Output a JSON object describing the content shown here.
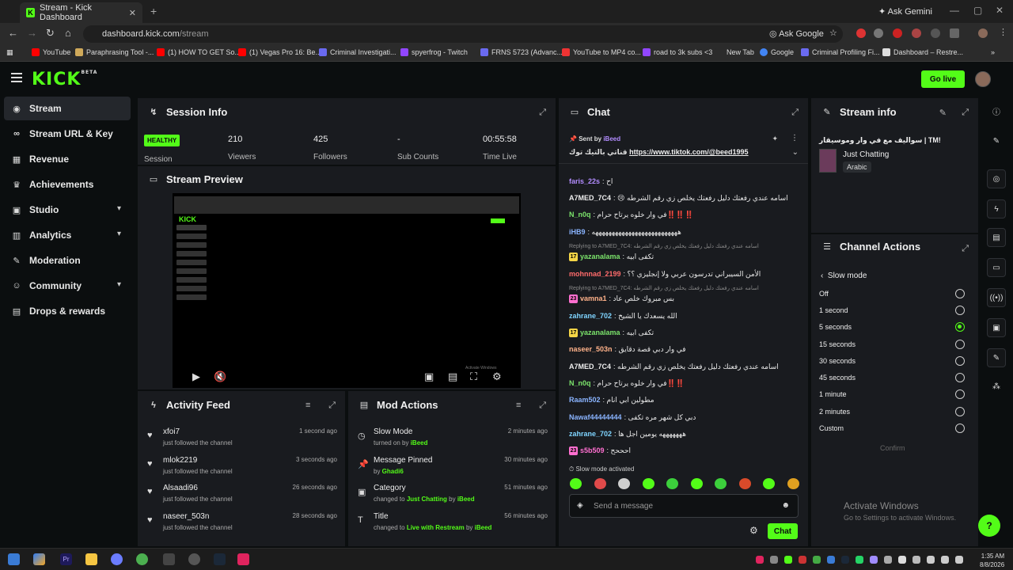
{
  "browser": {
    "tab_title": "Stream - Kick Dashboard",
    "tab_favicon": "K",
    "ask_gemini": "Ask Gemini",
    "url_domain": "dashboard.kick.com",
    "url_path": "/stream",
    "ask_google": "Ask Google",
    "bookmarks": [
      {
        "label": "YouTube",
        "color": "#ff0000"
      },
      {
        "label": "Paraphrasing Tool -...",
        "color": "#cfa95a"
      },
      {
        "label": "(1) HOW TO GET So...",
        "color": "#ff0000"
      },
      {
        "label": "(1) Vegas Pro 16: Be...",
        "color": "#ff0000"
      },
      {
        "label": "Criminal Investigati...",
        "color": "#6a6af0"
      },
      {
        "label": "spyerfrog - Twitch",
        "color": "#9146ff"
      },
      {
        "label": "FRNS 5723 (Advanc...",
        "color": "#6a6af0"
      },
      {
        "label": "YouTube to MP4 co...",
        "color": "#e33"
      },
      {
        "label": "road to 3k subs <3",
        "color": "#9146ff"
      },
      {
        "label": "New Tab",
        "color": "#2b2b2b"
      },
      {
        "label": "Google",
        "color": "#4285f4"
      },
      {
        "label": "Criminal Profiling Fi...",
        "color": "#6a6af0"
      },
      {
        "label": "Dashboard – Restre...",
        "color": "#ddd"
      }
    ]
  },
  "header": {
    "logo": "KICK",
    "logo_badge": "BETA",
    "go_live": "Go live"
  },
  "sidebar": {
    "items": [
      {
        "label": "Stream",
        "icon": "broadcast-icon",
        "glyph": "◉"
      },
      {
        "label": "Stream URL & Key",
        "icon": "link-icon",
        "glyph": "🔗"
      },
      {
        "label": "Revenue",
        "icon": "chart-icon",
        "glyph": "▦"
      },
      {
        "label": "Achievements",
        "icon": "trophy-icon",
        "glyph": "🏆"
      },
      {
        "label": "Studio",
        "icon": "layout-icon",
        "glyph": "▣"
      },
      {
        "label": "Analytics",
        "icon": "analytics-icon",
        "glyph": "▥"
      },
      {
        "label": "Moderation",
        "icon": "wrench-icon",
        "glyph": "✎"
      },
      {
        "label": "Community",
        "icon": "users-icon",
        "glyph": "☺"
      },
      {
        "label": "Drops & rewards",
        "icon": "gift-icon",
        "glyph": "▤"
      }
    ]
  },
  "session": {
    "title": "Session Info",
    "health": "HEALTHY",
    "label": "Session",
    "stats": [
      {
        "value": "210",
        "label": "Viewers"
      },
      {
        "value": "425",
        "label": "Followers"
      },
      {
        "value": "-",
        "label": "Sub Counts"
      },
      {
        "value": "00:55:58",
        "label": "Time Live"
      }
    ]
  },
  "preview": {
    "title": "Stream Preview",
    "activate_text": "Activate Windows"
  },
  "activity": {
    "title": "Activity Feed",
    "items": [
      {
        "name": "xfoi7",
        "sub": "just followed the channel",
        "time": "1 second ago"
      },
      {
        "name": "mlok2219",
        "sub": "just followed the channel",
        "time": "3 seconds ago"
      },
      {
        "name": "Alsaadi96",
        "sub": "just followed the channel",
        "time": "26 seconds ago"
      },
      {
        "name": "naseer_503n",
        "sub": "just followed the channel",
        "time": "28 seconds ago"
      }
    ]
  },
  "mod_actions": {
    "title": "Mod Actions",
    "items": [
      {
        "name": "Slow Mode",
        "pre": "turned on by ",
        "hl": "iBeed",
        "mid": "",
        "hl2": "",
        "time": "2 minutes ago",
        "icon": "clock-icon",
        "glyph": "◷"
      },
      {
        "name": "Message Pinned",
        "pre": "by ",
        "hl": "Ghadi6",
        "mid": "",
        "hl2": "",
        "time": "30 minutes ago",
        "icon": "pin-icon",
        "glyph": "✦"
      },
      {
        "name": "Category",
        "pre": "changed to ",
        "hl": "Just Chatting",
        "mid": " by ",
        "hl2": "iBeed",
        "time": "51 minutes ago",
        "icon": "category-icon",
        "glyph": "▣"
      },
      {
        "name": "Title",
        "pre": "changed to ",
        "hl": "Live with Restream",
        "mid": " by ",
        "hl2": "iBeed",
        "time": "56 minutes ago",
        "icon": "text-icon",
        "glyph": "T"
      }
    ]
  },
  "chat": {
    "title": "Chat",
    "pinned_sent_by": "Sent by",
    "pinned_user": "iBeed",
    "pinned_text": "قناتي بالتيك توك",
    "pinned_link": "https://www.tiktok.com/@beed1995",
    "messages": [
      {
        "user": "faris_22s",
        "color": "#b28cff",
        "text": "اح",
        "badge": ""
      },
      {
        "user": "A7MED_7C4",
        "color": "#eeeeee",
        "text": "😢 اسامه عندي رفعتك دليل رفعتك يخلص زي رقم الشرطه",
        "badge": ""
      },
      {
        "user": "N_n0q",
        "color": "#7be36b",
        "text": "في وار خلوه يرتاح حرام‼️‼️‼️",
        "badge": ""
      },
      {
        "user": "iHB9",
        "color": "#8ab4ff",
        "text": "ههههههههههههههههههههههههههه",
        "badge": ""
      },
      {
        "user": "yazanalama",
        "color": "#7be36b",
        "text": "تكفى ابيه",
        "badge": "17",
        "badge_color": "#f5d547",
        "reply": "Replying to A7MED_7C4: اسامه عندي رفعتك دليل رفعتك يخلص زي رقم الشرطه"
      },
      {
        "user": "mohnnad_2199",
        "color": "#ff6b6b",
        "text": "الأمن السيبراني تدرسون عربي ولا إنجليزي ؟؟",
        "badge": ""
      },
      {
        "user": "vamna1",
        "color": "#ffb28a",
        "text": "بس مبروك خلص عاد",
        "badge": "23",
        "badge_color": "#ff6fd0",
        "reply": "Replying to A7MED_7C4: اسامه عندي رفعتك دليل رفعتك يخلص زي رقم الشرطه"
      },
      {
        "user": "zahrane_702",
        "color": "#7fd4ff",
        "text": "الله يسعدك يا الشيخ",
        "badge": ""
      },
      {
        "user": "yazanalama",
        "color": "#7be36b",
        "text": "تكفى ابيه",
        "badge": "17",
        "badge_color": "#f5d547"
      },
      {
        "user": "naseer_503n",
        "color": "#ffb28a",
        "text": "في وار دبي قصة دقايق",
        "badge": ""
      },
      {
        "user": "A7MED_7C4",
        "color": "#eeeeee",
        "text": "اسامه عندي رفعتك دليل رفعتك يخلص زي رقم الشرطه",
        "badge": ""
      },
      {
        "user": "N_n0q",
        "color": "#7be36b",
        "text": "في وار خلوه يرتاح حرام‼️‼️",
        "badge": ""
      },
      {
        "user": "Raam502",
        "color": "#8ab4ff",
        "text": "مطولين ابي انام",
        "badge": ""
      },
      {
        "user": "Nawaf44444444",
        "color": "#8ab4ff",
        "text": "دبي كل شهر مره تكفى",
        "badge": ""
      },
      {
        "user": "zahrane_702",
        "color": "#7fd4ff",
        "text": "هههههههه يومين اجل ها",
        "badge": ""
      },
      {
        "user": "s5b509",
        "color": "#ff6fd0",
        "text": "احححح",
        "badge": "23",
        "badge_color": "#ff6fd0"
      }
    ],
    "slow_mode_notice": "Slow mode activated",
    "input_placeholder": "Send a message",
    "send_label": "Chat"
  },
  "stream_info": {
    "title": "Stream info",
    "stream_title": "سواليف مع في وار وموسيقار | TM!",
    "category": "Just Chatting",
    "language": "Arabic"
  },
  "channel_actions": {
    "title": "Channel Actions",
    "section": "Slow mode",
    "options": [
      {
        "label": "Off",
        "selected": false
      },
      {
        "label": "1 second",
        "selected": false
      },
      {
        "label": "5 seconds",
        "selected": true
      },
      {
        "label": "15 seconds",
        "selected": false
      },
      {
        "label": "30 seconds",
        "selected": false
      },
      {
        "label": "45 seconds",
        "selected": false
      },
      {
        "label": "1 minute",
        "selected": false
      },
      {
        "label": "2 minutes",
        "selected": false
      },
      {
        "label": "Custom",
        "selected": false
      }
    ],
    "confirm": "Confirm"
  },
  "watermark": {
    "line1": "Activate Windows",
    "line2": "Go to Settings to activate Windows."
  },
  "taskbar": {
    "time": "1:35 AM",
    "date": "8/8/2026"
  },
  "colors": {
    "accent": "#53fc18",
    "panel": "#191b1f",
    "background": "#0b0e0f"
  }
}
